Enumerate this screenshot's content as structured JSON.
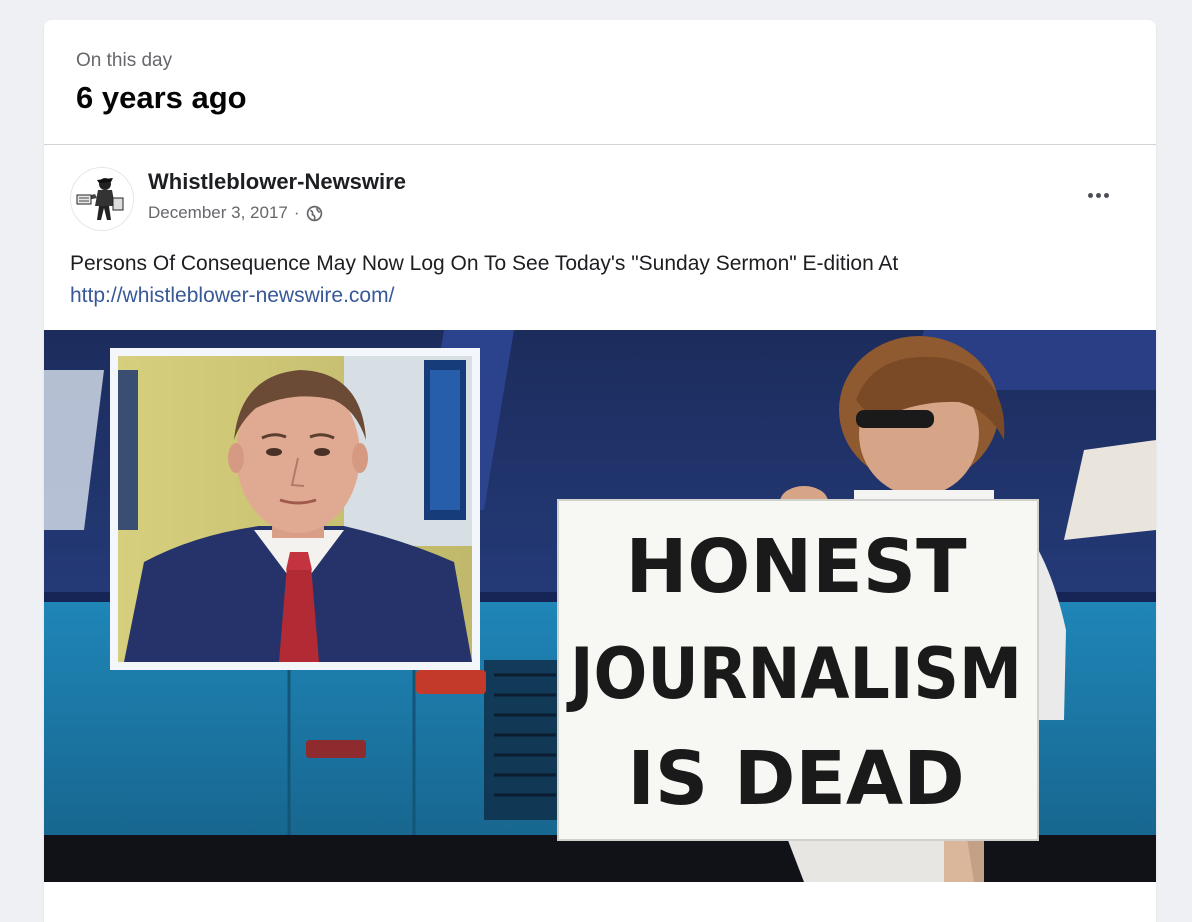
{
  "memory": {
    "kicker": "On this day",
    "title": "6 years ago"
  },
  "post": {
    "author": "Whistleblower-Newswire",
    "date": "December 3, 2017",
    "date_separator": "·",
    "privacy_icon": "globe-icon",
    "more_icon": "more-options-icon",
    "text": "Persons Of Consequence May Now Log On To See Today's \"Sunday Sermon\" E-dition At",
    "link": "http://whistleblower-newswire.com/",
    "image": {
      "sign_lines": [
        "HONEST",
        "JOURNALISM",
        "IS DEAD"
      ]
    }
  },
  "colors": {
    "link": "#385898",
    "secondary_text": "#65676b",
    "background": "#eef0f4"
  }
}
